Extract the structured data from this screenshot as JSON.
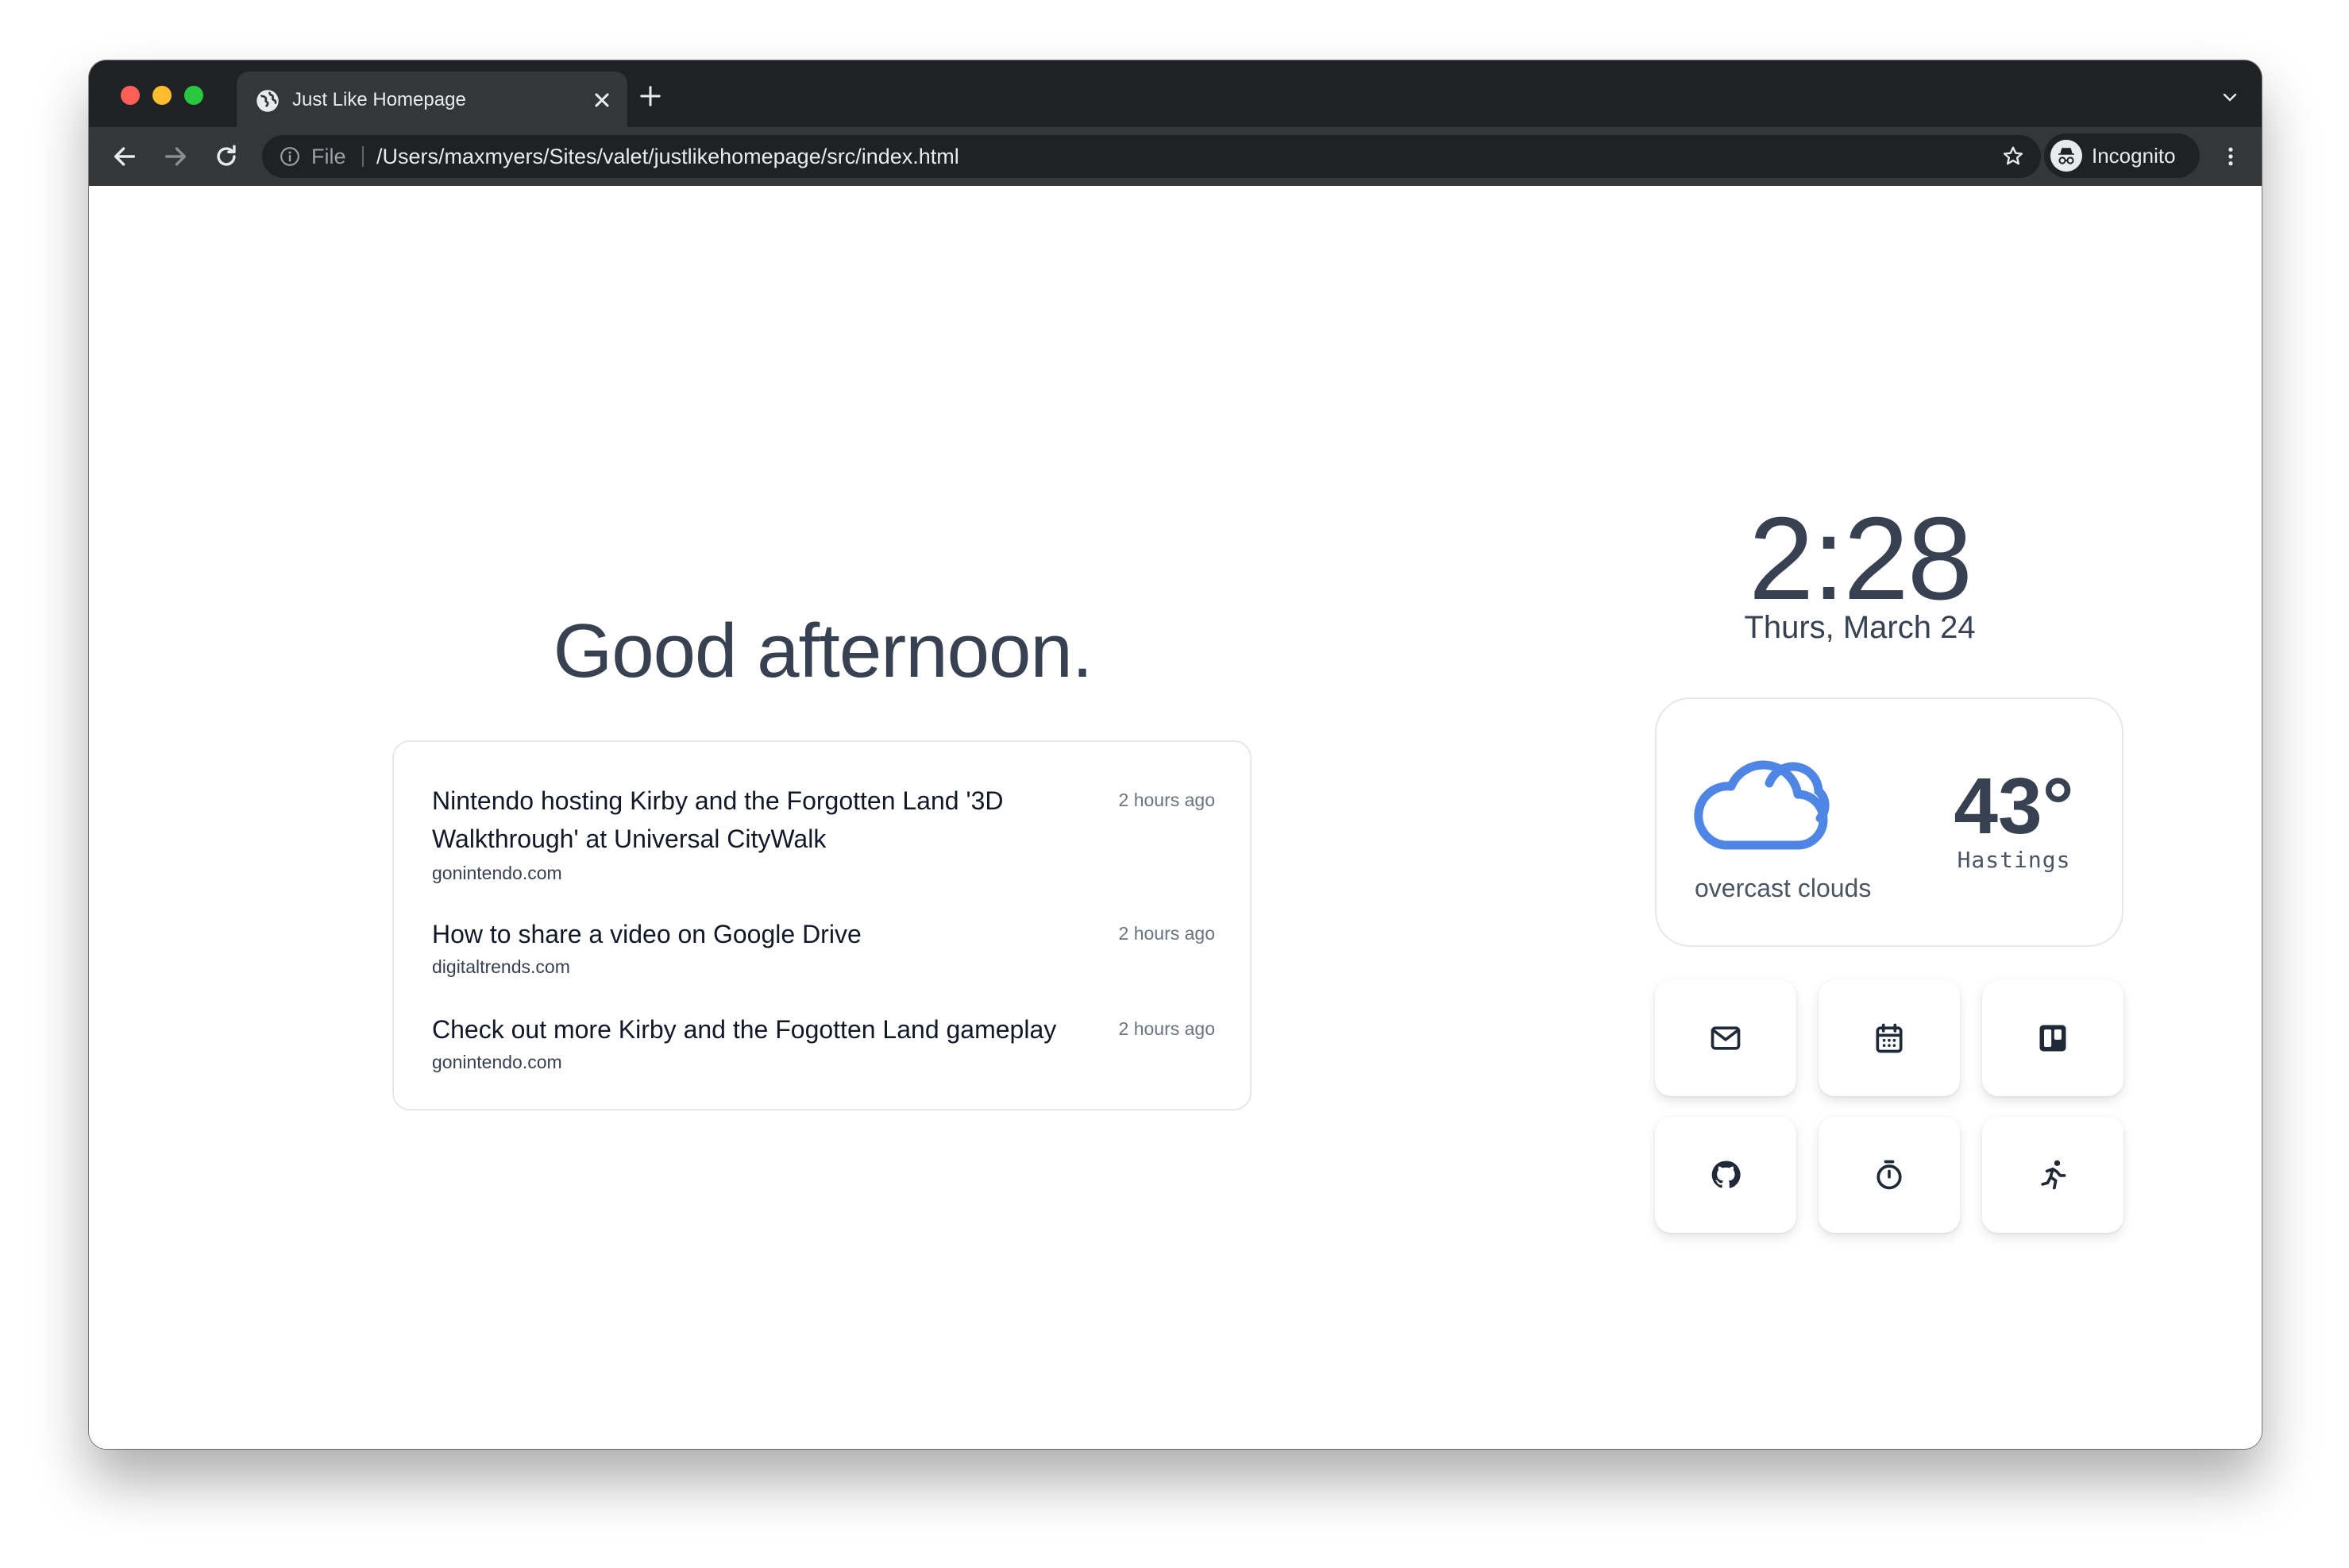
{
  "browser": {
    "tab_title": "Just Like Homepage",
    "url_scheme": "File",
    "url": "/Users/maxmyers/Sites/valet/justlikehomepage/src/index.html",
    "profile_label": "Incognito"
  },
  "page": {
    "greeting": "Good afternoon.",
    "news": [
      {
        "title": "Nintendo hosting Kirby and the Forgotten Land '3D Walkthrough' at Universal CityWalk",
        "source": "gonintendo.com",
        "time": "2 hours ago"
      },
      {
        "title": "How to share a video on Google Drive",
        "source": "digitaltrends.com",
        "time": "2 hours ago"
      },
      {
        "title": "Check out more Kirby and the Fogotten Land gameplay",
        "source": "gonintendo.com",
        "time": "2 hours ago"
      }
    ],
    "clock": "2:28",
    "date": "Thurs, March 24",
    "weather": {
      "temperature": "43°",
      "city": "Hastings",
      "description": "overcast clouds",
      "icon": "cloud-icon"
    },
    "shortcuts": [
      {
        "icon": "mail-icon"
      },
      {
        "icon": "calendar-icon"
      },
      {
        "icon": "trello-icon"
      },
      {
        "icon": "github-icon"
      },
      {
        "icon": "timer-icon"
      },
      {
        "icon": "running-icon"
      }
    ]
  },
  "colors": {
    "chrome_dark": "#202124",
    "chrome_toolbar": "#35363a",
    "text_primary": "#374151",
    "weather_icon": "#4f86e6"
  }
}
